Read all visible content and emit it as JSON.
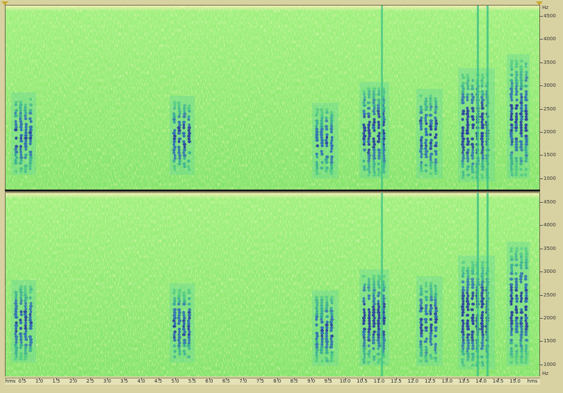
{
  "hz_unit": "Hz",
  "time_unit": "hms",
  "freq_ticks": [
    "4500",
    "4000",
    "3500",
    "3000",
    "2500",
    "2000",
    "1500",
    "1000"
  ],
  "time_ticks": [
    "0.5",
    "1.0",
    "1.5",
    "2.0",
    "2.5",
    "3.0",
    "3.5",
    "4.0",
    "4.5",
    "5.0",
    "5.5",
    "6.0",
    "6.5",
    "7.0",
    "7.5",
    "8.0",
    "8.5",
    "9.0",
    "9.5",
    "10.0",
    "10.5",
    "11.0",
    "11.5",
    "12.0",
    "12.5",
    "13.0",
    "13.5",
    "14.0",
    "14.5",
    "15.0"
  ],
  "colors": {
    "background_green": "#8ee874",
    "energy_blue": "#2a3fa0",
    "mid_teal": "#2aa39a",
    "light_yellow": "#e8f0a0"
  },
  "channels": [
    "left",
    "right"
  ]
}
